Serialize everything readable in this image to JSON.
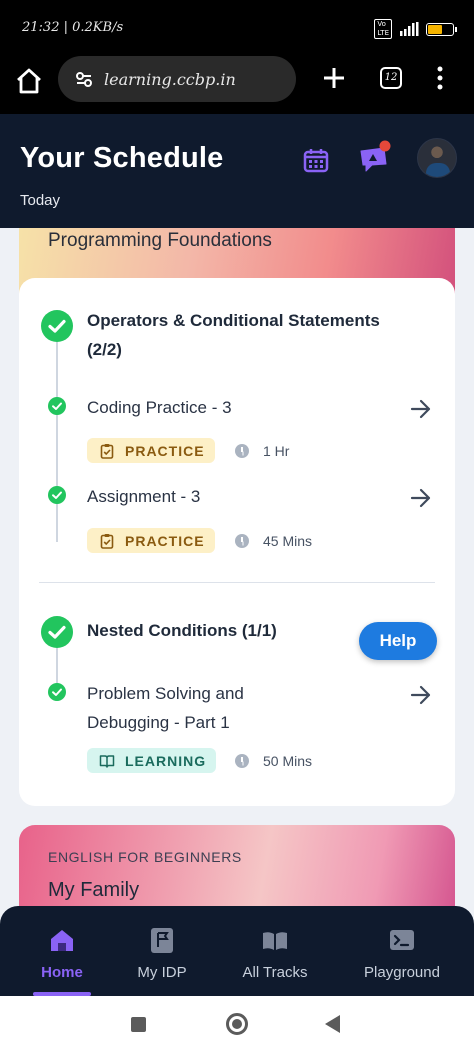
{
  "status_bar": {
    "time": "21:32",
    "speed": "0.2KB/s",
    "battery_level": 0.55
  },
  "browser": {
    "url": "learning.ccbp.in",
    "tab_count": "12"
  },
  "header": {
    "title": "Your Schedule",
    "subtitle": "Today"
  },
  "top_course": {
    "name": "Programming Foundations"
  },
  "sections": [
    {
      "title_line1": "Operators & Conditional Statements",
      "title_line2": "(2/2)",
      "items": [
        {
          "title": "Coding Practice - 3",
          "tag": "PRACTICE",
          "duration": "1 Hr"
        },
        {
          "title": "Assignment - 3",
          "tag": "PRACTICE",
          "duration": "45 Mins"
        }
      ]
    },
    {
      "title_line1": "Nested Conditions (1/1)",
      "items": [
        {
          "title_line1": "Problem Solving and",
          "title_line2": "Debugging - Part 1",
          "tag": "LEARNING",
          "duration": "50 Mins"
        }
      ]
    }
  ],
  "next_card": {
    "category": "ENGLISH FOR BEGINNERS",
    "name": "My Family"
  },
  "help": {
    "label": "Help"
  },
  "bottom_nav": [
    {
      "label": "Home",
      "icon": "home-icon",
      "active": true
    },
    {
      "label": "My IDP",
      "icon": "flag-icon"
    },
    {
      "label": "All Tracks",
      "icon": "book-icon"
    },
    {
      "label": "Playground",
      "icon": "terminal-icon"
    }
  ],
  "colors": {
    "accent": "#8a63f5",
    "success": "#22c55e",
    "header_bg": "#0f1a2d",
    "help_blue": "#1e7be0"
  }
}
